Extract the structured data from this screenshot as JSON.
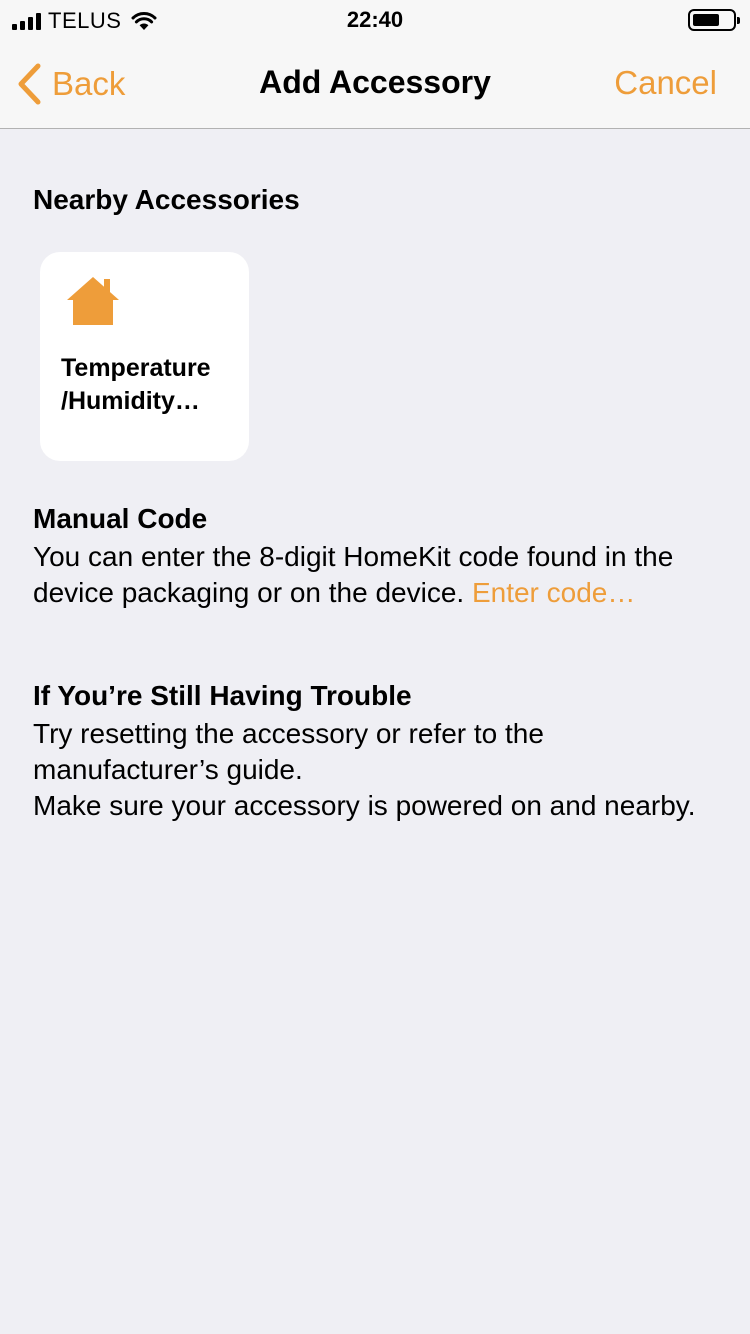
{
  "status_bar": {
    "carrier": "TELUS",
    "time": "22:40",
    "signal_icon": "cellular-signal-icon",
    "wifi_icon": "wifi-icon",
    "battery_icon": "battery-icon"
  },
  "nav": {
    "back_label": "Back",
    "title": "Add Accessory",
    "cancel_label": "Cancel"
  },
  "nearby": {
    "heading": "Nearby Accessories",
    "accessories": [
      {
        "icon": "home-icon",
        "name_line1": "Temperature",
        "name_line2": "/Humidity…"
      }
    ]
  },
  "manual_code": {
    "heading": "Manual Code",
    "text": "You can enter the 8-digit HomeKit code found in the device packaging or on the device. ",
    "link": "Enter code…"
  },
  "trouble": {
    "heading": "If You’re Still Having Trouble",
    "line1": "Try resetting the accessory or refer to the manufacturer’s guide.",
    "line2": "Make sure your accessory is powered on and nearby."
  },
  "colors": {
    "accent": "#ee9d3a",
    "background": "#efeff4",
    "bar": "#f7f7f7"
  }
}
